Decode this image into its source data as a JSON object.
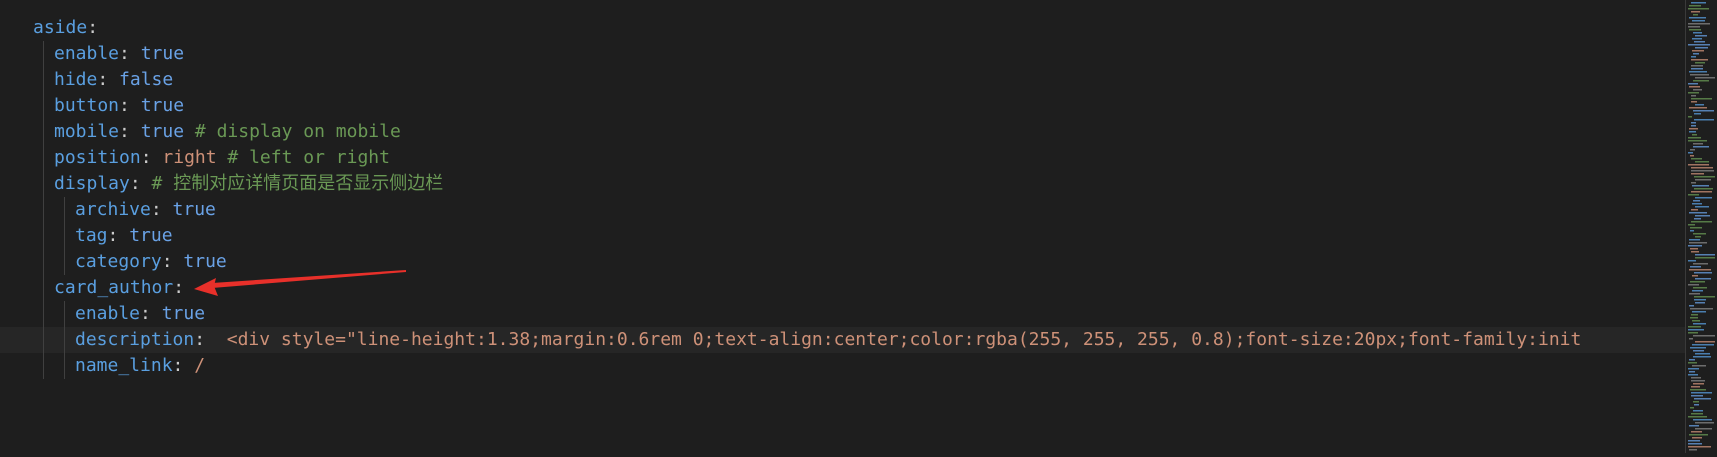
{
  "editor": {
    "lines": [
      {
        "indent": 0,
        "key": "aside",
        "colon": ":"
      },
      {
        "indent": 1,
        "key": "enable",
        "colon": ": ",
        "value": "true",
        "vtype": "b"
      },
      {
        "indent": 1,
        "key": "hide",
        "colon": ": ",
        "value": "false",
        "vtype": "b"
      },
      {
        "indent": 1,
        "key": "button",
        "colon": ": ",
        "value": "true",
        "vtype": "b"
      },
      {
        "indent": 1,
        "key": "mobile",
        "colon": ": ",
        "value": "true",
        "vtype": "b",
        "comment": " # display on mobile"
      },
      {
        "indent": 1,
        "key": "position",
        "colon": ": ",
        "value": "right",
        "vtype": "s",
        "comment": " # left or right"
      },
      {
        "indent": 1,
        "key": "display",
        "colon": ": ",
        "comment": "# 控制对应详情页面是否显示侧边栏"
      },
      {
        "indent": 2,
        "key": "archive",
        "colon": ": ",
        "value": "true",
        "vtype": "b"
      },
      {
        "indent": 2,
        "key": "tag",
        "colon": ": ",
        "value": "true",
        "vtype": "b"
      },
      {
        "indent": 2,
        "key": "category",
        "colon": ": ",
        "value": "true",
        "vtype": "b"
      },
      {
        "indent": 1,
        "key": "card_author",
        "colon": ":"
      },
      {
        "indent": 2,
        "key": "enable",
        "colon": ": ",
        "value": "true",
        "vtype": "b"
      },
      {
        "indent": 2,
        "key": "description",
        "colon": ":  ",
        "value": "<div style=\"line-height:1.38;margin:0.6rem 0;text-align:center;color:rgba(255, 255, 255, 0.8);font-size:20px;font-family:init",
        "vtype": "s",
        "current": true
      },
      {
        "indent": 2,
        "key": "name_link",
        "colon": ": ",
        "value": "/",
        "vtype": "s"
      }
    ]
  },
  "annotation": {
    "color": "#e8302a",
    "target": "card_author"
  }
}
